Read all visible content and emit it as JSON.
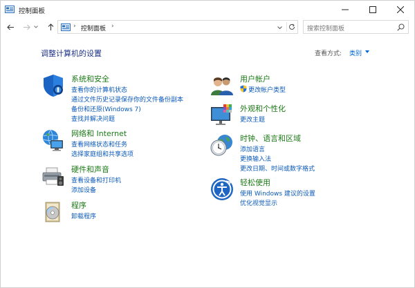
{
  "window": {
    "title": "控制面板",
    "colors": {
      "accent": "#0b5ab8",
      "category_title": "#1c7a17",
      "heading": "#1e3287"
    }
  },
  "titlebar": {
    "min_icon": "minimize-icon",
    "max_icon": "maximize-icon",
    "close_icon": "close-icon"
  },
  "navigation": {
    "address_segment": "控制面板",
    "search_placeholder": "搜索控制面板"
  },
  "main": {
    "heading": "调整计算机的设置",
    "view_by_label": "查看方式:",
    "view_by_value": "类别",
    "categories": [
      {
        "title": "系统和安全",
        "icon": "system-security-icon",
        "links": [
          "查看你的计算机状态",
          "通过文件历史记录保存你的文件备份副本",
          "备份和还原(Windows 7)",
          "查找并解决问题"
        ]
      },
      {
        "title": "网络和 Internet",
        "icon": "network-icon",
        "links": [
          "查看网络状态和任务",
          "选择家庭组和共享选项"
        ]
      },
      {
        "title": "硬件和声音",
        "icon": "hardware-sound-icon",
        "links": [
          "查看设备和打印机",
          "添加设备"
        ]
      },
      {
        "title": "程序",
        "icon": "programs-icon",
        "links": [
          "卸载程序"
        ]
      },
      {
        "title": "用户帐户",
        "icon": "user-accounts-icon",
        "links": [
          "更改帐户类型"
        ]
      },
      {
        "title": "外观和个性化",
        "icon": "appearance-icon",
        "links": [
          "更改主题"
        ]
      },
      {
        "title": "时钟、语言和区域",
        "icon": "clock-region-icon",
        "links": [
          "添加语言",
          "更换输入法",
          "更改日期、时间或数字格式"
        ]
      },
      {
        "title": "轻松使用",
        "icon": "ease-of-access-icon",
        "links": [
          "使用 Windows 建议的设置",
          "优化视觉显示"
        ]
      }
    ]
  }
}
